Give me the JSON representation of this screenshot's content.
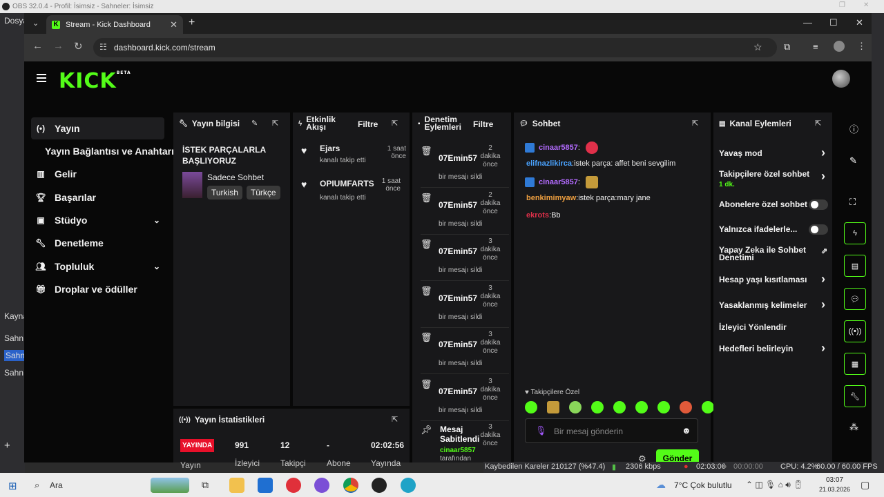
{
  "obs": {
    "title": "OBS 32.0.4 - Profil: İsimsiz - Sahneler: İsimsiz",
    "menu_dosya": "Dosya",
    "scenes_label": "Kayna",
    "scene_items": [
      "Sahn",
      "Sahn",
      "Sahn"
    ],
    "add": "+",
    "status": {
      "dropped": "Kaybedilen Kareler 210127 (%47.4)",
      "bitrate": "2306 kbps",
      "rec_time": "02:03:06",
      "stream_time": "00:00:00",
      "cpu": "CPU: 4.2%",
      "fps": "60.00 / 60.00 FPS"
    }
  },
  "browser": {
    "tab_title": "Stream - Kick Dashboard",
    "url": "dashboard.kick.com/stream"
  },
  "kick": {
    "logo": "KICK",
    "beta": "BETA"
  },
  "sidebar": {
    "items": [
      {
        "label": "Yayın",
        "icon": "stream-icon"
      },
      {
        "label": "Yayın Bağlantısı ve Anahtarı"
      },
      {
        "label": "Gelir",
        "icon": "chart-icon"
      },
      {
        "label": "Başarılar",
        "icon": "trophy-icon"
      },
      {
        "label": "Stüdyo",
        "icon": "studio-icon"
      },
      {
        "label": "Denetleme",
        "icon": "wrench-icon"
      },
      {
        "label": "Topluluk",
        "icon": "community-icon"
      },
      {
        "label": "Droplar ve ödüller",
        "icon": "gift-icon"
      }
    ]
  },
  "yayin_bilgisi": {
    "header": "Yayın bilgisi",
    "title": "İSTEK PARÇALARLA BAŞLIYORUZ",
    "category": "Sadece Sohbet",
    "tags": [
      "Turkish",
      "Türkçe"
    ]
  },
  "etkinlik": {
    "header_line1": "Etkinlik",
    "header_line2": "Akışı",
    "filter": "Filtre",
    "items": [
      {
        "name": "Ejars",
        "action": "kanalı takip etti",
        "time": "1 saat önce"
      },
      {
        "name": "OPIUMFARTS",
        "action": "kanalı takip etti",
        "time_line1": "1 saat",
        "time_line2": "önce"
      }
    ]
  },
  "denetim": {
    "header_line1": "Denetim",
    "header_line2": "Eylemleri",
    "filter": "Filtre",
    "items": [
      {
        "user": "07Emin57",
        "num": "2",
        "unit": "dakika",
        "ago": "önce",
        "action": "bir mesajı sildi"
      },
      {
        "user": "07Emin57",
        "num": "2",
        "unit": "dakika",
        "ago": "önce",
        "action": "bir mesajı sildi"
      },
      {
        "user": "07Emin57",
        "num": "3",
        "unit": "dakika",
        "ago": "önce",
        "action": "bir mesajı sildi"
      },
      {
        "user": "07Emin57",
        "num": "3",
        "unit": "dakika",
        "ago": "önce",
        "action": "bir mesajı sildi"
      },
      {
        "user": "07Emin57",
        "num": "3",
        "unit": "dakika",
        "ago": "önce",
        "action": "bir mesajı sildi"
      },
      {
        "user": "07Emin57",
        "num": "3",
        "unit": "dakika",
        "ago": "önce",
        "action": "bir mesajı sildi"
      }
    ],
    "pinned": {
      "title_line1": "Mesaj",
      "title_line2": "Sabitlendi",
      "num": "3",
      "unit": "dakika",
      "ago": "önce",
      "by": "cinaar5857",
      "by_suffix": "tarafından"
    }
  },
  "istatistik": {
    "header": "Yayın İstatistikleri",
    "live": "YAYINDA",
    "viewers": "991",
    "followers": "12",
    "subs": "-",
    "uptime": "02:02:56",
    "label_yayin": "Yayın",
    "label_izleyici": "İzleyici",
    "label_takipci": "Takipçi",
    "label_abone": "Abone",
    "label_yayinda": "Yayında"
  },
  "sohbet": {
    "header": "Sohbet",
    "messages": [
      {
        "user": "cinaar5857",
        "sep": ":",
        "text": "",
        "color": "#b36bff"
      },
      {
        "user": "elifnazlikirca",
        "sep": ":",
        "text": " istek parça: affet beni sevgilim",
        "color": "#4aa3ff"
      },
      {
        "user": "cinaar5857",
        "sep": ":",
        "text": "",
        "color": "#b36bff"
      },
      {
        "user": "benkimimyaw",
        "sep": ":",
        "text": " istek parça:mary jane",
        "color": "#f0a040"
      },
      {
        "user": "ekrots",
        "sep": ":",
        "text": " Bb",
        "color": "#e0304a"
      }
    ],
    "followers_only": "Takipçilere Özel",
    "placeholder": "Bir mesaj gönderin",
    "send": "Gönder"
  },
  "kanal": {
    "header": "Kanal Eylemleri",
    "rows": [
      {
        "label": "Yavaş mod"
      },
      {
        "label": "Takipçilere özel sohbet",
        "sub": "1 dk."
      },
      {
        "label": "Abonelere özel sohbet"
      },
      {
        "label": "Yalnızca ifadelerle..."
      },
      {
        "label": "Yapay Zeka ile Sohbet Denetimi"
      },
      {
        "label": "Hesap yaşı kısıtlaması"
      },
      {
        "label": "Yasaklanmış kelimeler"
      },
      {
        "label": "İzleyici Yönlendir"
      },
      {
        "label": "Hedefleri belirleyin"
      }
    ]
  },
  "taskbar": {
    "search": "Ara",
    "weather": "7°C  Çok bulutlu",
    "time": "03:07",
    "date": "21.03.2026"
  },
  "colors": {
    "kick_green": "#53fc18",
    "live_red": "#e8102a"
  }
}
